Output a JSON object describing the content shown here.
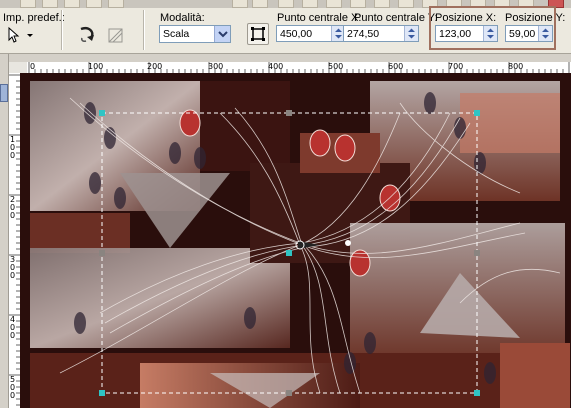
{
  "toolbar": {
    "preset_label": "Imp. predef.:",
    "mode_label": "Modalità:",
    "mode_value": "Scala",
    "center_x_label": "Punto centrale X:",
    "center_x_value": "450,00",
    "center_y_label": "Punto centrale Y:",
    "center_y_value": "274,50",
    "pos_x_label": "Posizione X:",
    "pos_x_value": "123,00",
    "pos_y_label": "Posizione Y:",
    "pos_y_value": "59,00"
  },
  "ruler_h": {
    "labels": [
      "0",
      "100",
      "200",
      "300",
      "400",
      "500",
      "600",
      "700",
      "800"
    ]
  },
  "ruler_v": {
    "labels": [
      "1\n0\n0",
      "2\n0\n0",
      "3\n0\n0",
      "4\n0\n0",
      "5\n0\n0"
    ]
  },
  "colors": {
    "highlight": "#a0705e",
    "handle": "#2fc4c4",
    "accent": "#7f9db9"
  },
  "icons": {
    "pick_tool": "arrow-cursor-icon",
    "rotate": "rotate-icon",
    "transform": "transform-icon",
    "mode_dropdown": "chevron-down-icon",
    "reset": "square-reset-icon"
  }
}
